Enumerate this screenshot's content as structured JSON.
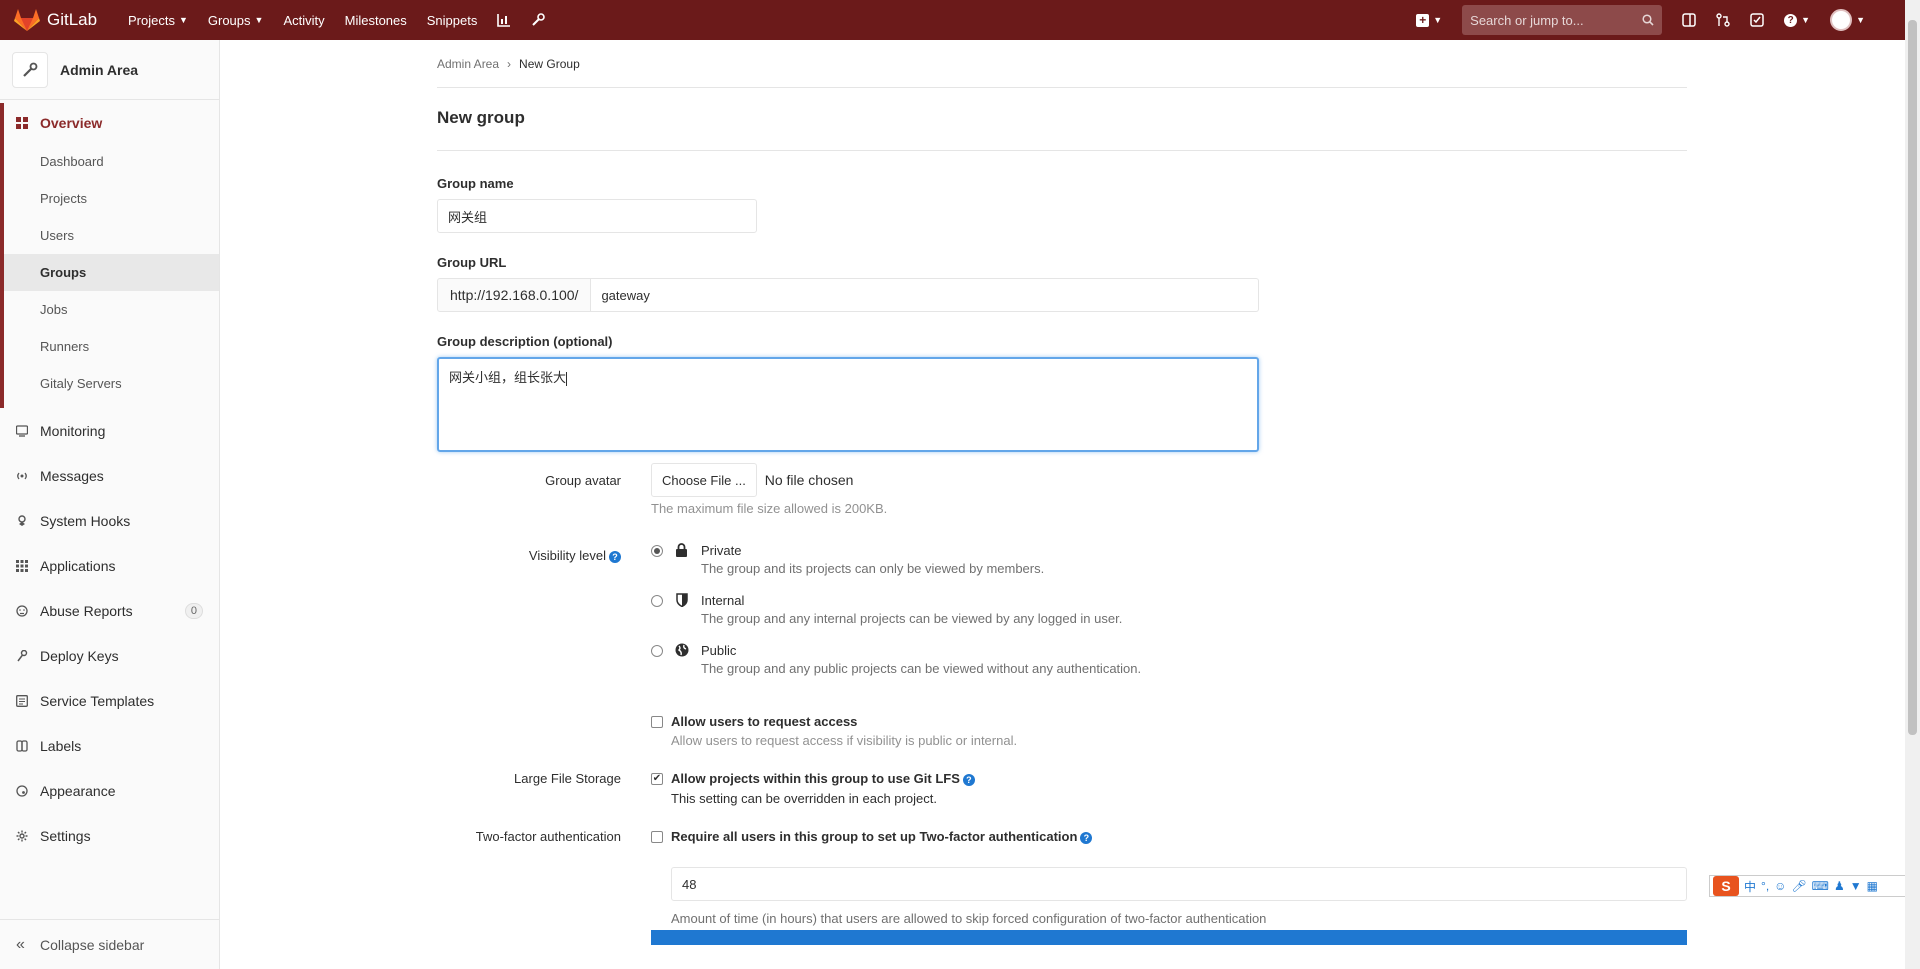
{
  "navbar": {
    "brand": "GitLab",
    "items": [
      {
        "label": "Projects",
        "caret": true
      },
      {
        "label": "Groups",
        "caret": true
      },
      {
        "label": "Activity",
        "caret": false
      },
      {
        "label": "Milestones",
        "caret": false
      },
      {
        "label": "Snippets",
        "caret": false
      }
    ],
    "search_placeholder": "Search or jump to..."
  },
  "sidebar": {
    "title": "Admin Area",
    "overview_label": "Overview",
    "sub_items": [
      "Dashboard",
      "Projects",
      "Users",
      "Groups",
      "Jobs",
      "Runners",
      "Gitaly Servers"
    ],
    "active_sub": "Groups",
    "items": [
      {
        "label": "Monitoring",
        "icon": "monitor-icon"
      },
      {
        "label": "Messages",
        "icon": "broadcast-icon"
      },
      {
        "label": "System Hooks",
        "icon": "hook-icon"
      },
      {
        "label": "Applications",
        "icon": "grid-icon"
      },
      {
        "label": "Abuse Reports",
        "icon": "abuse-icon",
        "count": "0"
      },
      {
        "label": "Deploy Keys",
        "icon": "key-icon"
      },
      {
        "label": "Service Templates",
        "icon": "template-icon"
      },
      {
        "label": "Labels",
        "icon": "label-icon"
      },
      {
        "label": "Appearance",
        "icon": "palette-icon"
      },
      {
        "label": "Settings",
        "icon": "gear-icon"
      }
    ],
    "collapse_label": "Collapse sidebar"
  },
  "breadcrumb": {
    "parent": "Admin Area",
    "current": "New Group"
  },
  "page_title": "New group",
  "form": {
    "group_name_label": "Group name",
    "group_name_value": "网关组",
    "group_url_label": "Group URL",
    "url_prefix": "http://192.168.0.100/",
    "url_value": "gateway",
    "description_label": "Group description (optional)",
    "description_value": "网关小组，组长张大",
    "avatar_label": "Group avatar",
    "choose_file": "Choose File ...",
    "no_file": "No file chosen",
    "avatar_help": "The maximum file size allowed is 200KB.",
    "visibility_label": "Visibility level",
    "visibility_options": [
      {
        "title": "Private",
        "desc": "The group and its projects can only be viewed by members.",
        "checked": true,
        "icon": "lock-icon"
      },
      {
        "title": "Internal",
        "desc": "The group and any internal projects can be viewed by any logged in user.",
        "checked": false,
        "icon": "shield-icon"
      },
      {
        "title": "Public",
        "desc": "The group and any public projects can be viewed without any authentication.",
        "checked": false,
        "icon": "globe-icon"
      }
    ],
    "request_access_title": "Allow users to request access",
    "request_access_desc": "Allow users to request access if visibility is public or internal.",
    "lfs_label": "Large File Storage",
    "lfs_title": "Allow projects within this group to use Git LFS",
    "lfs_desc": "This setting can be overridden in each project.",
    "tfa_label": "Two-factor authentication",
    "tfa_title": "Require all users in this group to set up Two-factor authentication",
    "grace_value": "48",
    "grace_help": "Amount of time (in hours) that users are allowed to skip forced configuration of two-factor authentication"
  },
  "ime": {
    "logo": "S",
    "lang": "中"
  }
}
